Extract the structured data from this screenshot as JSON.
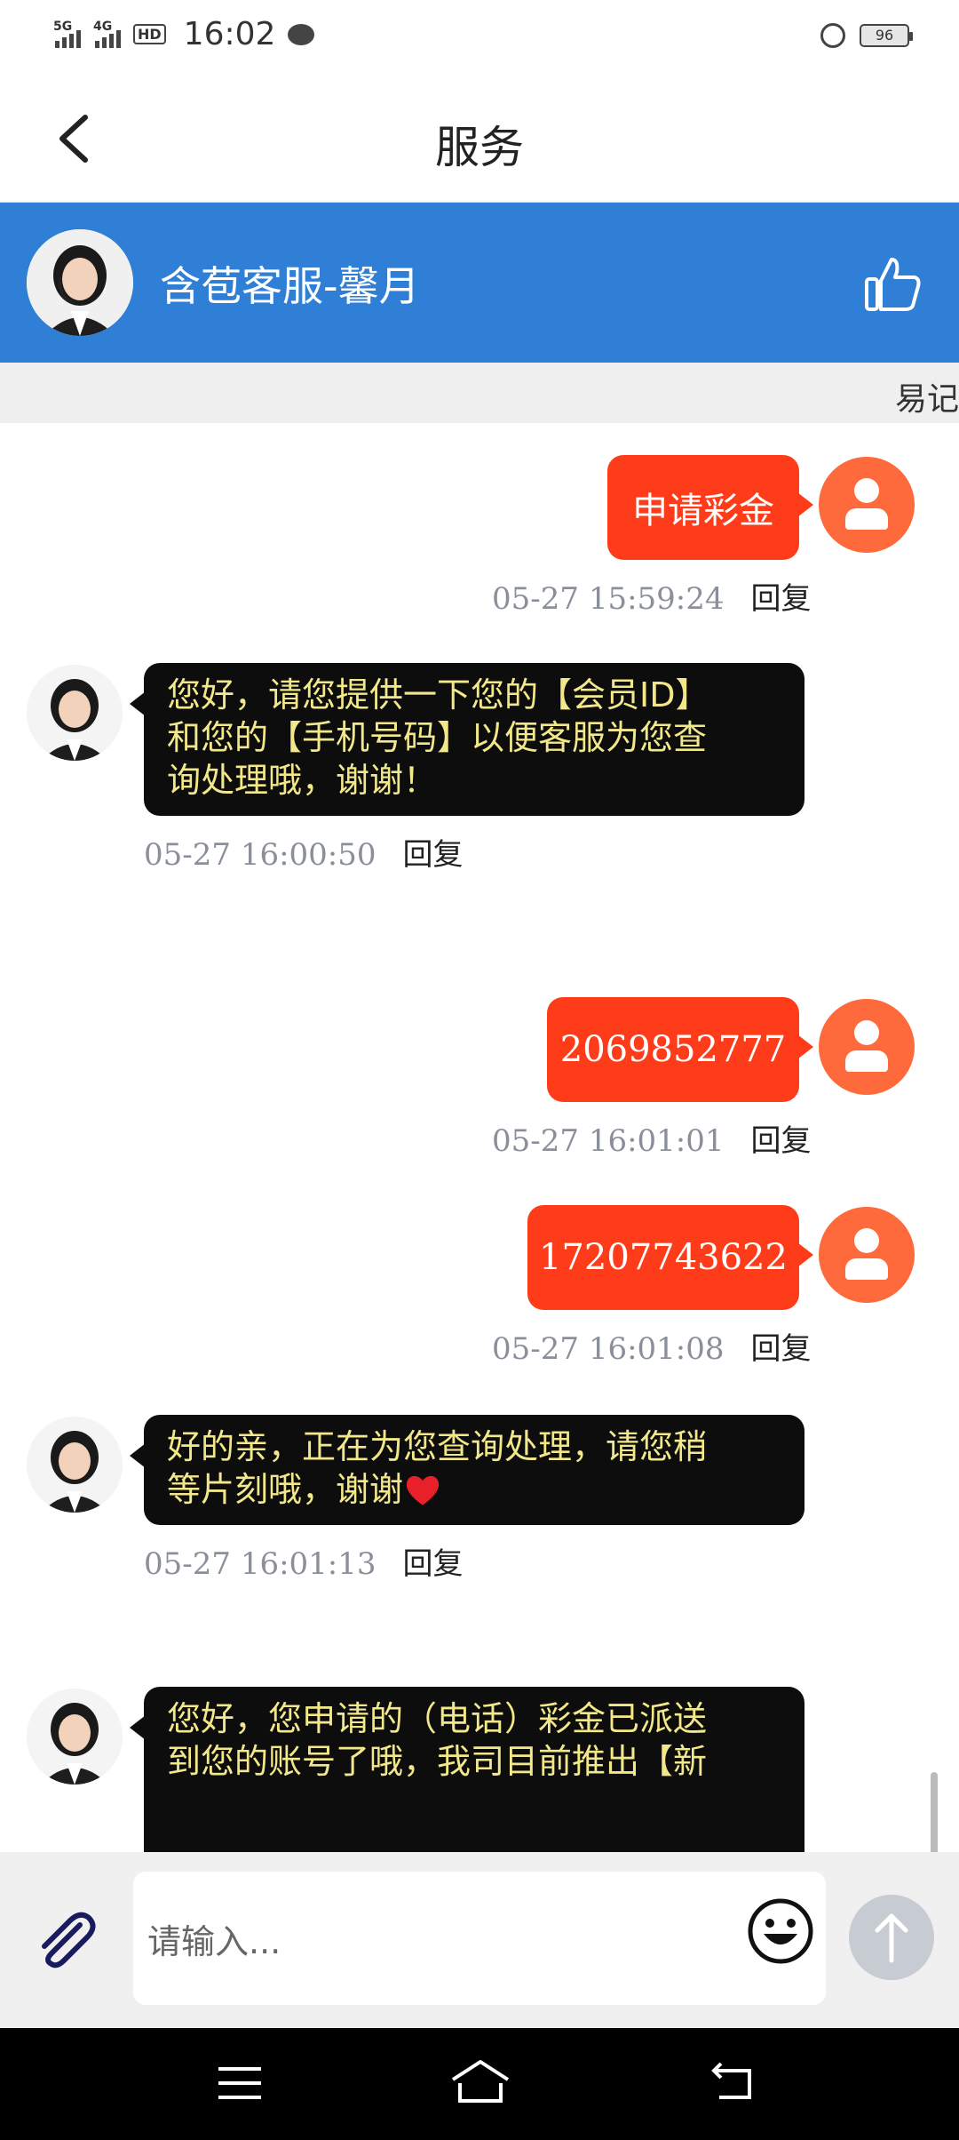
{
  "status_bar": {
    "sig1": "5G",
    "sig2": "4G",
    "hd": "HD",
    "time": "16:02",
    "battery": "96"
  },
  "header": {
    "title": "服务"
  },
  "agent": {
    "name": "含苞客服-馨月"
  },
  "strip": {
    "text": "易记"
  },
  "messages": [
    {
      "side": "out",
      "text": "申请彩金",
      "timestamp": "05-27 15:59:24",
      "reply": "回复"
    },
    {
      "side": "in",
      "lines": [
        "您好，请您提供一下您的【会员ID】",
        "和您的【手机号码】以便客服为您查",
        "询处理哦，谢谢！"
      ],
      "timestamp": "05-27 16:00:50",
      "reply": "回复"
    },
    {
      "side": "out",
      "text": "2069852777",
      "timestamp": "05-27 16:01:01",
      "reply": "回复"
    },
    {
      "side": "out",
      "text": "17207743622",
      "timestamp": "05-27 16:01:08",
      "reply": "回复"
    },
    {
      "side": "in",
      "lines": [
        "好的亲，正在为您查询处理，请您稍",
        "等片刻哦，谢谢"
      ],
      "timestamp": "05-27 16:01:13",
      "reply": "回复"
    },
    {
      "side": "in",
      "lines": [
        "您好，您申请的（电话）彩金已派送",
        "到您的账号了哦，我司目前推出【新"
      ]
    }
  ],
  "input": {
    "placeholder": "请输入..."
  },
  "icons": {
    "back": "chevron-left-icon",
    "like": "thumbs-up-icon",
    "attach": "paperclip-icon",
    "emoji": "smiley-icon",
    "send": "arrow-up-icon",
    "heart": "heart-icon"
  },
  "colors": {
    "header_blue": "#2f7fd6",
    "user_bubble": "#ff3c1a",
    "agent_bubble": "#0d0d0d",
    "agent_text": "#f2e88a",
    "user_avatar": "#ff6a3d"
  }
}
